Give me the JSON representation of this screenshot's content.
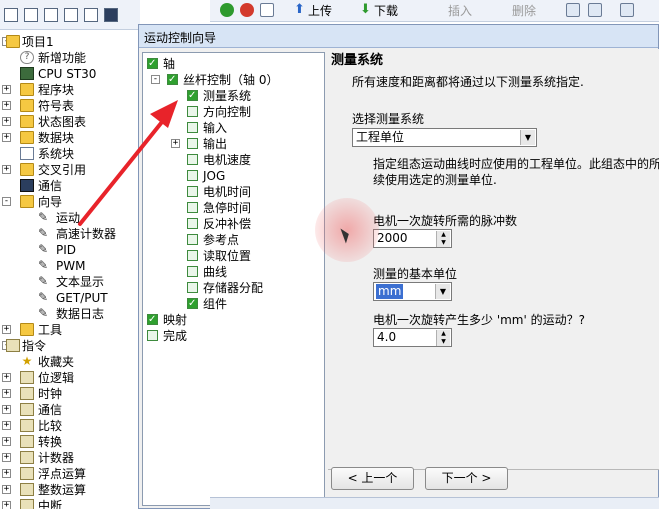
{
  "app_toolbar": {
    "upload_label": "上传",
    "download_label": "下载",
    "insert_label": "插入",
    "delete_label": "删除"
  },
  "left_tree": {
    "items": [
      {
        "label": "项目1",
        "icon": "project-icon"
      },
      {
        "label": "新增功能",
        "icon": "help-icon"
      },
      {
        "label": "CPU ST30",
        "icon": "cpu-icon"
      },
      {
        "label": "程序块",
        "icon": "folder-icon"
      },
      {
        "label": "符号表",
        "icon": "folder-icon"
      },
      {
        "label": "状态图表",
        "icon": "folder-icon"
      },
      {
        "label": "数据块",
        "icon": "folder-icon"
      },
      {
        "label": "系统块",
        "icon": "doc-icon"
      },
      {
        "label": "交叉引用",
        "icon": "folder-icon"
      },
      {
        "label": "通信",
        "icon": "monitor-icon"
      },
      {
        "label": "向导",
        "icon": "folder-icon"
      },
      {
        "label": "运动",
        "icon": "wizard-icon"
      },
      {
        "label": "高速计数器",
        "icon": "wizard-icon"
      },
      {
        "label": "PID",
        "icon": "wizard-icon"
      },
      {
        "label": "PWM",
        "icon": "wizard-icon"
      },
      {
        "label": "文本显示",
        "icon": "wizard-icon"
      },
      {
        "label": "GET/PUT",
        "icon": "wizard-icon"
      },
      {
        "label": "数据日志",
        "icon": "wizard-icon"
      },
      {
        "label": "工具",
        "icon": "folder-icon"
      },
      {
        "label": "指令",
        "icon": "instruction-icon"
      },
      {
        "label": "收藏夹",
        "icon": "favorites-icon"
      },
      {
        "label": "位逻辑",
        "icon": "instruction-icon"
      },
      {
        "label": "时钟",
        "icon": "instruction-icon"
      },
      {
        "label": "通信",
        "icon": "instruction-icon"
      },
      {
        "label": "比较",
        "icon": "instruction-icon"
      },
      {
        "label": "转换",
        "icon": "instruction-icon"
      },
      {
        "label": "计数器",
        "icon": "instruction-icon"
      },
      {
        "label": "浮点运算",
        "icon": "instruction-icon"
      },
      {
        "label": "整数运算",
        "icon": "instruction-icon"
      },
      {
        "label": "中断",
        "icon": "instruction-icon"
      }
    ]
  },
  "dialog": {
    "title": "运动控制向导",
    "steps": [
      {
        "label": "轴",
        "checked": true
      },
      {
        "label": "丝杆控制（轴 0）",
        "checked": true
      },
      {
        "label": "测量系统",
        "checked": true
      },
      {
        "label": "方向控制",
        "checked": false
      },
      {
        "label": "输入",
        "checked": false
      },
      {
        "label": "输出",
        "checked": false
      },
      {
        "label": "电机速度",
        "checked": false
      },
      {
        "label": "JOG",
        "checked": false
      },
      {
        "label": "电机时间",
        "checked": false
      },
      {
        "label": "急停时间",
        "checked": false
      },
      {
        "label": "反冲补偿",
        "checked": false
      },
      {
        "label": "参考点",
        "checked": false
      },
      {
        "label": "读取位置",
        "checked": false
      },
      {
        "label": "曲线",
        "checked": false
      },
      {
        "label": "存储器分配",
        "checked": false
      },
      {
        "label": "组件",
        "checked": true
      },
      {
        "label": "映射",
        "checked": true
      },
      {
        "label": "完成",
        "checked": false
      }
    ],
    "panel": {
      "heading": "测量系统",
      "description": "所有速度和距离都将通过以下测量系统指定.",
      "select_label": "选择测量系统",
      "select_value": "工程单位",
      "note_line1": "指定组态运动曲线时应使用的工程单位。此组态中的所",
      "note_line2": "续使用选定的测量单位.",
      "pulses_label": "电机一次旋转所需的脉冲数",
      "pulses_value": "2000",
      "unit_label": "测量的基本单位",
      "unit_value": "mm",
      "travel_label": "电机一次旋转产生多少 'mm' 的运动？?",
      "travel_value": "4.0"
    },
    "prev_button": "< 上一个",
    "next_button": "下一个 >"
  },
  "colors": {
    "annotation": "#e8232a",
    "dialog_title_bg": "#d7e4f5",
    "check_green": "#2fa02f"
  }
}
